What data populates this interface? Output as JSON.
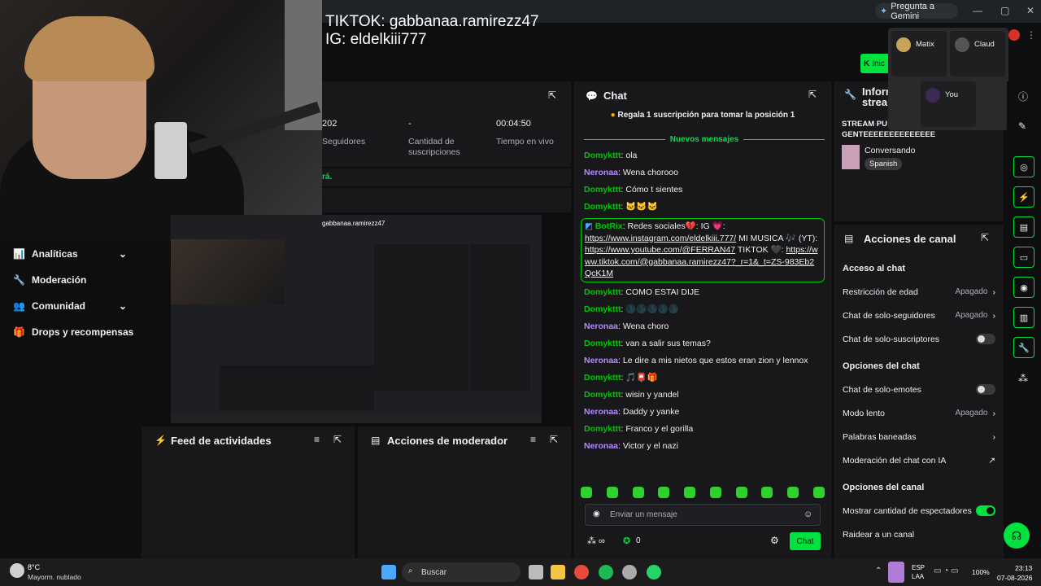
{
  "browser": {
    "gemini_label": "Pregunta a Gemini",
    "controls": [
      "—",
      "▢",
      "✕"
    ]
  },
  "overlay": {
    "tiktok": "TIKTOK: gabbanaa.ramirezz47",
    "ig": "IG: eldelkiii777"
  },
  "nav": {
    "items": [
      {
        "label": "Analíticas",
        "has_chevron": true
      },
      {
        "label": "Moderación",
        "has_chevron": false
      },
      {
        "label": "Comunidad",
        "has_chevron": true
      },
      {
        "label": "Drops y recompensas",
        "has_chevron": false
      }
    ]
  },
  "stats": {
    "followers_value": "202",
    "followers_label": "Seguidores",
    "subs_value": "-",
    "subs_label": "Cantidad de suscripciones",
    "live_value": "00:04:50",
    "live_label": "Tiempo en vivo",
    "partial_text": "rá."
  },
  "preview": {
    "overlay_text": "gabbanaa.ramirezz47"
  },
  "feed": {
    "title": "Feed de actividades"
  },
  "mod_actions": {
    "title": "Acciones de moderador"
  },
  "chat": {
    "title": "Chat",
    "sub_banner": "Regala 1 suscripción para tomar la posición 1",
    "new_messages": "Nuevos mensajes",
    "messages": [
      {
        "user": "Domykttt",
        "color": "green",
        "text": "ola"
      },
      {
        "user": "Neronaa",
        "color": "purple",
        "text": "Wena chorooo"
      },
      {
        "user": "Domykttt",
        "color": "green",
        "text": "Cómo t sientes"
      },
      {
        "user": "Domykttt",
        "color": "green",
        "text": "🐱🐱🐱"
      }
    ],
    "bot": {
      "user": "BotRix",
      "text1": "Redes sociales💔: IG 💗:",
      "link1": "https://www.instagram.com/eldelkiii.777/",
      "text2": "MI MUSICA 🎶 (YT):",
      "link2": "https://www.youtube.com/@FERRAN47",
      "text3": "TIKTOK 🖤:",
      "link3": "https://www.tiktok.com/@gabbanaa.ramirezz47?_r=1&_t=ZS-983Eb2QcK1M"
    },
    "messages2": [
      {
        "user": "Domykttt",
        "color": "green",
        "text": "COMO ESTAI DIJE"
      },
      {
        "user": "Domykttt",
        "color": "green",
        "text": "🌑🌑🌑🌑🌑"
      },
      {
        "user": "Neronaa",
        "color": "purple",
        "text": "Wena choro"
      },
      {
        "user": "Domykttt",
        "color": "green",
        "text": "van a salir sus temas?"
      },
      {
        "user": "Neronaa",
        "color": "purple",
        "text": "Le dire a mis nietos que estos eran zion y lennox"
      },
      {
        "user": "Domykttt",
        "color": "green",
        "text": "🎵📮🎁"
      },
      {
        "user": "Domykttt",
        "color": "green",
        "text": "wisin y yandel"
      },
      {
        "user": "Neronaa",
        "color": "purple",
        "text": "Daddy y yanke"
      },
      {
        "user": "Domykttt",
        "color": "green",
        "text": "Franco y el gorilla"
      },
      {
        "user": "Neronaa",
        "color": "purple",
        "text": "Victor y el nazi"
      }
    ],
    "input_placeholder": "Enviar un mensaje",
    "points": "0",
    "send_label": "Chat"
  },
  "stream_info": {
    "title_partial": "Inform stream",
    "stream_title": "STREAM PU GENTEEEEEEEEEEEEEE",
    "category": "Conversando",
    "language": "Spanish"
  },
  "channel_actions": {
    "title": "Acciones de canal",
    "sections": [
      {
        "heading": "Acceso al chat",
        "rows": [
          {
            "label": "Restricción de edad",
            "value": "Apagado",
            "kind": "chevron"
          },
          {
            "label": "Chat de solo-seguidores",
            "value": "Apagado",
            "kind": "chevron"
          },
          {
            "label": "Chat de solo-suscriptores",
            "value": "",
            "kind": "toggle-off"
          }
        ]
      },
      {
        "heading": "Opciones del chat",
        "rows": [
          {
            "label": "Chat de solo-emotes",
            "value": "",
            "kind": "toggle-off"
          },
          {
            "label": "Modo lento",
            "value": "Apagado",
            "kind": "chevron"
          },
          {
            "label": "Palabras baneadas",
            "value": "",
            "kind": "chevron"
          },
          {
            "label": "Moderación del chat con IA",
            "value": "",
            "kind": "external"
          }
        ]
      },
      {
        "heading": "Opciones del canal",
        "rows": [
          {
            "label": "Mostrar cantidad de espectadores",
            "value": "",
            "kind": "toggle-on"
          },
          {
            "label": "Raidear a un canal",
            "value": "",
            "kind": "none"
          }
        ]
      }
    ]
  },
  "collab": {
    "users": [
      "Matix",
      "Claud",
      "You"
    ]
  },
  "start_button": "Inic",
  "taskbar": {
    "weather_temp": "8°C",
    "weather_desc": "Mayorm. nublado",
    "search": "Buscar",
    "lang1": "ESP",
    "lang2": "LAA",
    "battery": "100%",
    "time": "23:13",
    "date": "07-08-2026"
  },
  "colors": {
    "accent": "#00e33f",
    "bg": "#0e0e10",
    "panel": "#18181b"
  }
}
